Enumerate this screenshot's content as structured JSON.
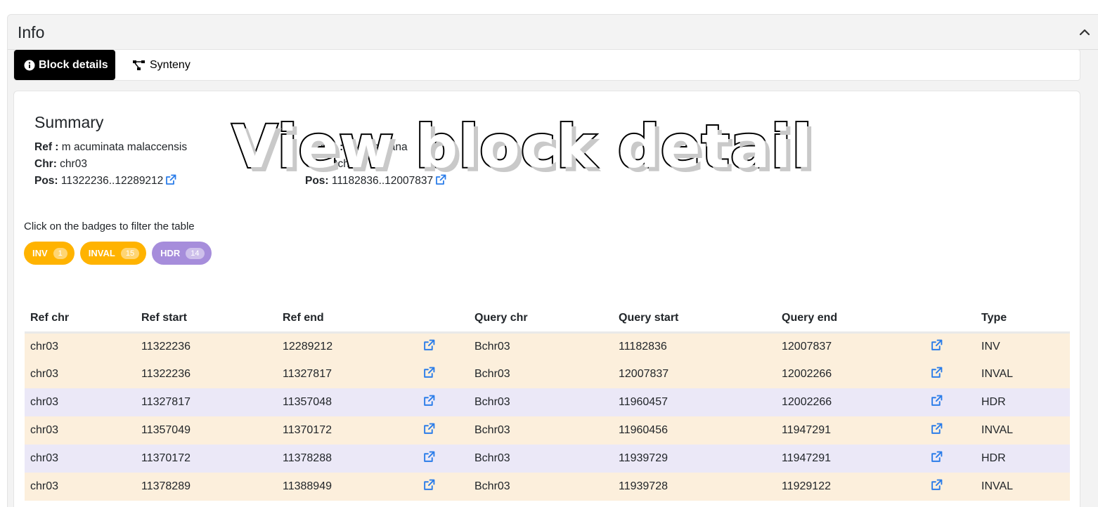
{
  "panel": {
    "title": "Info"
  },
  "tabs": [
    {
      "label": "Block details",
      "icon": "info-circle-icon",
      "active": true
    },
    {
      "label": "Synteny",
      "icon": "synteny-diagram-icon",
      "active": false
    }
  ],
  "summary": {
    "title": "Summary",
    "ref": {
      "species_label": "Ref :",
      "species": "m acuminata malaccensis",
      "chr_label": "Chr:",
      "chr": "chr03",
      "pos_label": "Pos:",
      "pos": "11322236..12289212"
    },
    "query": {
      "species_label": "Query :",
      "species": "m balbisiana",
      "chr_label": "Chr:",
      "chr": "Bchr03",
      "pos_label": "Pos:",
      "pos": "11182836..12007837"
    }
  },
  "filter": {
    "hint": "Click on the badges to filter the table",
    "badges": [
      {
        "label": "INV",
        "count": "1",
        "color": "#ffb300"
      },
      {
        "label": "INVAL",
        "count": "15",
        "color": "#ffb300"
      },
      {
        "label": "HDR",
        "count": "14",
        "color": "#a68ddb"
      }
    ]
  },
  "overlay": {
    "text": "View block detail"
  },
  "table": {
    "headers": [
      "Ref chr",
      "Ref start",
      "Ref end",
      "",
      "Query chr",
      "Query start",
      "Query end",
      "",
      "Type"
    ],
    "rows": [
      {
        "ref_chr": "chr03",
        "ref_start": "11322236",
        "ref_end": "12289212",
        "query_chr": "Bchr03",
        "query_start": "11182836",
        "query_end": "12007837",
        "type": "INV"
      },
      {
        "ref_chr": "chr03",
        "ref_start": "11322236",
        "ref_end": "11327817",
        "query_chr": "Bchr03",
        "query_start": "12007837",
        "query_end": "12002266",
        "type": "INVAL"
      },
      {
        "ref_chr": "chr03",
        "ref_start": "11327817",
        "ref_end": "11357048",
        "query_chr": "Bchr03",
        "query_start": "11960457",
        "query_end": "12002266",
        "type": "HDR"
      },
      {
        "ref_chr": "chr03",
        "ref_start": "11357049",
        "ref_end": "11370172",
        "query_chr": "Bchr03",
        "query_start": "11960456",
        "query_end": "11947291",
        "type": "INVAL"
      },
      {
        "ref_chr": "chr03",
        "ref_start": "11370172",
        "ref_end": "11378288",
        "query_chr": "Bchr03",
        "query_start": "11939729",
        "query_end": "11947291",
        "type": "HDR"
      },
      {
        "ref_chr": "chr03",
        "ref_start": "11378289",
        "ref_end": "11388949",
        "query_chr": "Bchr03",
        "query_start": "11939728",
        "query_end": "11929122",
        "type": "INVAL"
      }
    ]
  },
  "colors": {
    "inv_row": "#fcefdc",
    "hdr_row": "#ebe8f7",
    "link": "#2b7de9",
    "active_tab": "#000000"
  }
}
